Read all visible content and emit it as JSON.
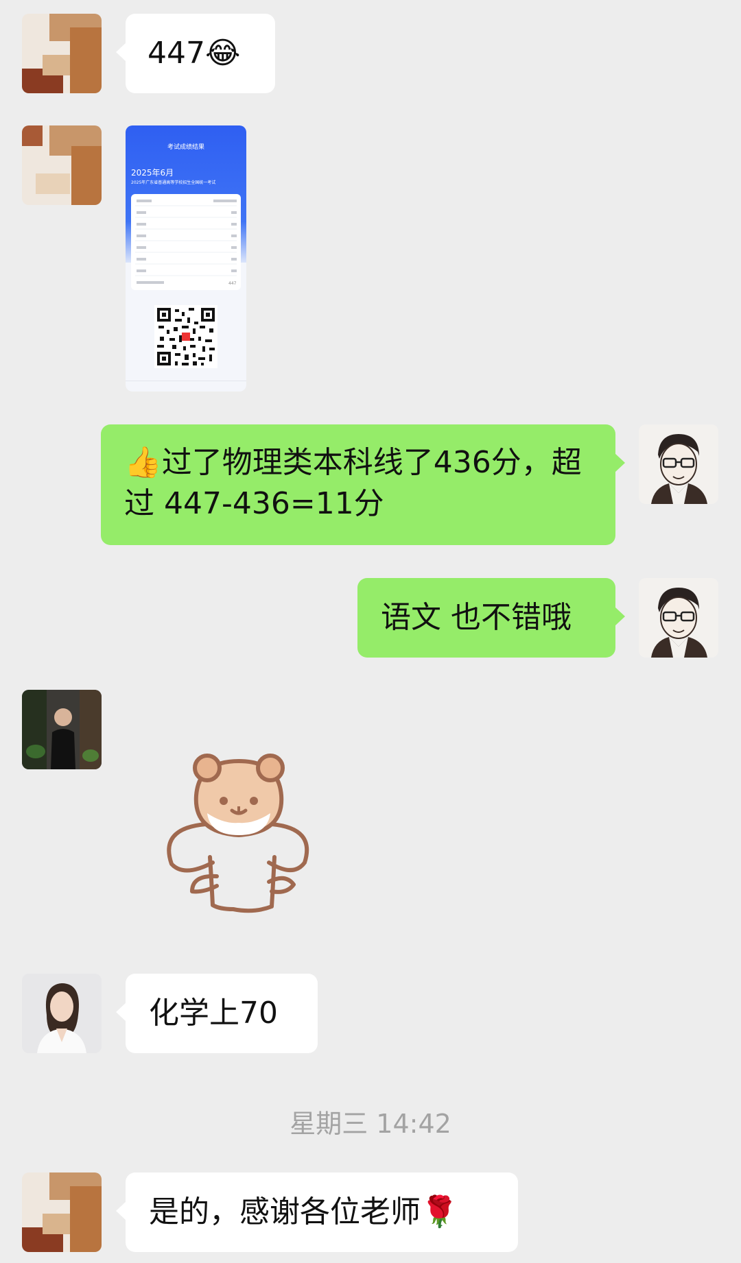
{
  "messages": [
    {
      "sender": "friend-1",
      "text": "447",
      "emoji": "😂"
    },
    {
      "sender": "friend-1",
      "type": "image",
      "screenshot": {
        "page_title": "考试成绩结果",
        "month": "2025年6月",
        "exam_name": "2025年广东省普通高等学校招生全国统一考试",
        "total": "447"
      }
    },
    {
      "sender": "me",
      "emoji": "👍",
      "text": "过了物理类本科线了436分，超过 447-436=11分"
    },
    {
      "sender": "me",
      "text": "语文 也不错哦"
    },
    {
      "sender": "friend-2",
      "type": "sticker",
      "sticker": "hamster-sticker"
    },
    {
      "sender": "friend-3",
      "text": "化学上70"
    },
    {
      "type": "timestamp",
      "text": "星期三 14:42"
    },
    {
      "sender": "friend-1",
      "text": "是的，感谢各位老师",
      "emoji": "🌹"
    }
  ],
  "colors": {
    "background": "#ededed",
    "incoming": "#ffffff",
    "outgoing": "#95ec69",
    "timestamp": "#a3a3a3"
  }
}
